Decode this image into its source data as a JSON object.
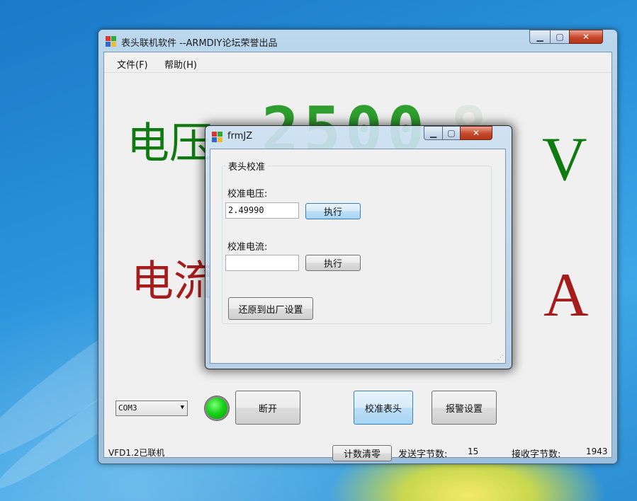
{
  "main_window": {
    "title": "表头联机软件 --ARMDIY论坛荣誉出品",
    "menu": [
      "文件(F)",
      "帮助(H)"
    ],
    "voltage_label": "电压",
    "current_label": "电流",
    "voltage_unit": "V",
    "current_unit": "A",
    "voltage_digits": "2500",
    "port_select": {
      "value": "COM3"
    },
    "buttons": {
      "disconnect": "断开",
      "calibrate": "校准表头",
      "alarm": "报警设置",
      "reset_count": "计数清零"
    },
    "status": {
      "device": "VFD1.2已联机",
      "sent_label": "发送字节数:",
      "sent_value": "15",
      "recv_label": "接收字节数:",
      "recv_value": "1943"
    }
  },
  "dialog": {
    "title": "frmJZ",
    "group_title": "表头校准",
    "voltage_cal_label": "校准电压:",
    "voltage_cal_value": "2.49990",
    "current_cal_label": "校准电流:",
    "current_cal_value": "",
    "execute": "执行",
    "factory_reset": "还原到出厂设置"
  },
  "colors": {
    "voltage": "#0f7a0f",
    "current": "#a51c1c",
    "digit": "#2e9e2e",
    "led": "#18d418"
  },
  "icons": [
    "app-icon",
    "minimize-icon",
    "maximize-icon",
    "close-icon",
    "dropdown-arrow-icon",
    "resize-grip-icon"
  ]
}
